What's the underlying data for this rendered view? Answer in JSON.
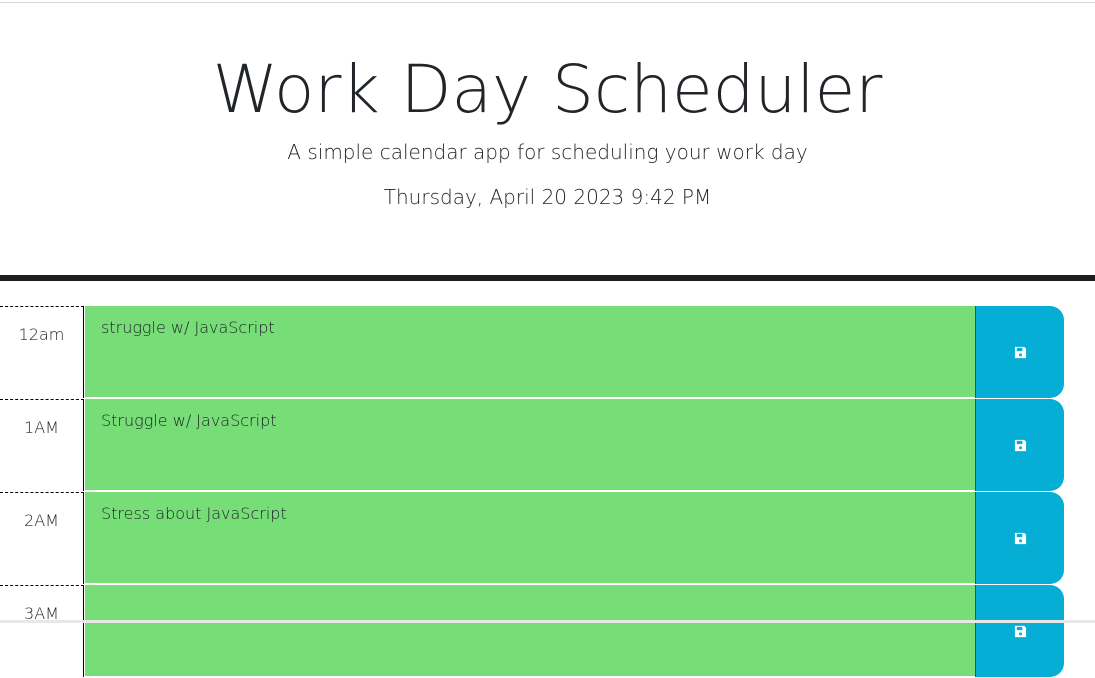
{
  "header": {
    "title": "Work Day Scheduler",
    "lead": "A simple calendar app for scheduling your work day",
    "current_day": "Thursday, April 20 2023 9:42 PM"
  },
  "time_blocks": [
    {
      "hour": "12am",
      "description": "struggle w/ JavaScript",
      "status": "future"
    },
    {
      "hour": "1AM",
      "description": "Struggle w/ JavaScript",
      "status": "future"
    },
    {
      "hour": "2AM",
      "description": "Stress about JavaScript",
      "status": "future"
    },
    {
      "hour": "3AM",
      "description": "",
      "status": "future"
    }
  ],
  "icons": {
    "save": "floppy-disk-icon"
  },
  "colors": {
    "future": "#77dd77",
    "save_button": "#06aed5",
    "header_border": "#1c1f22"
  }
}
